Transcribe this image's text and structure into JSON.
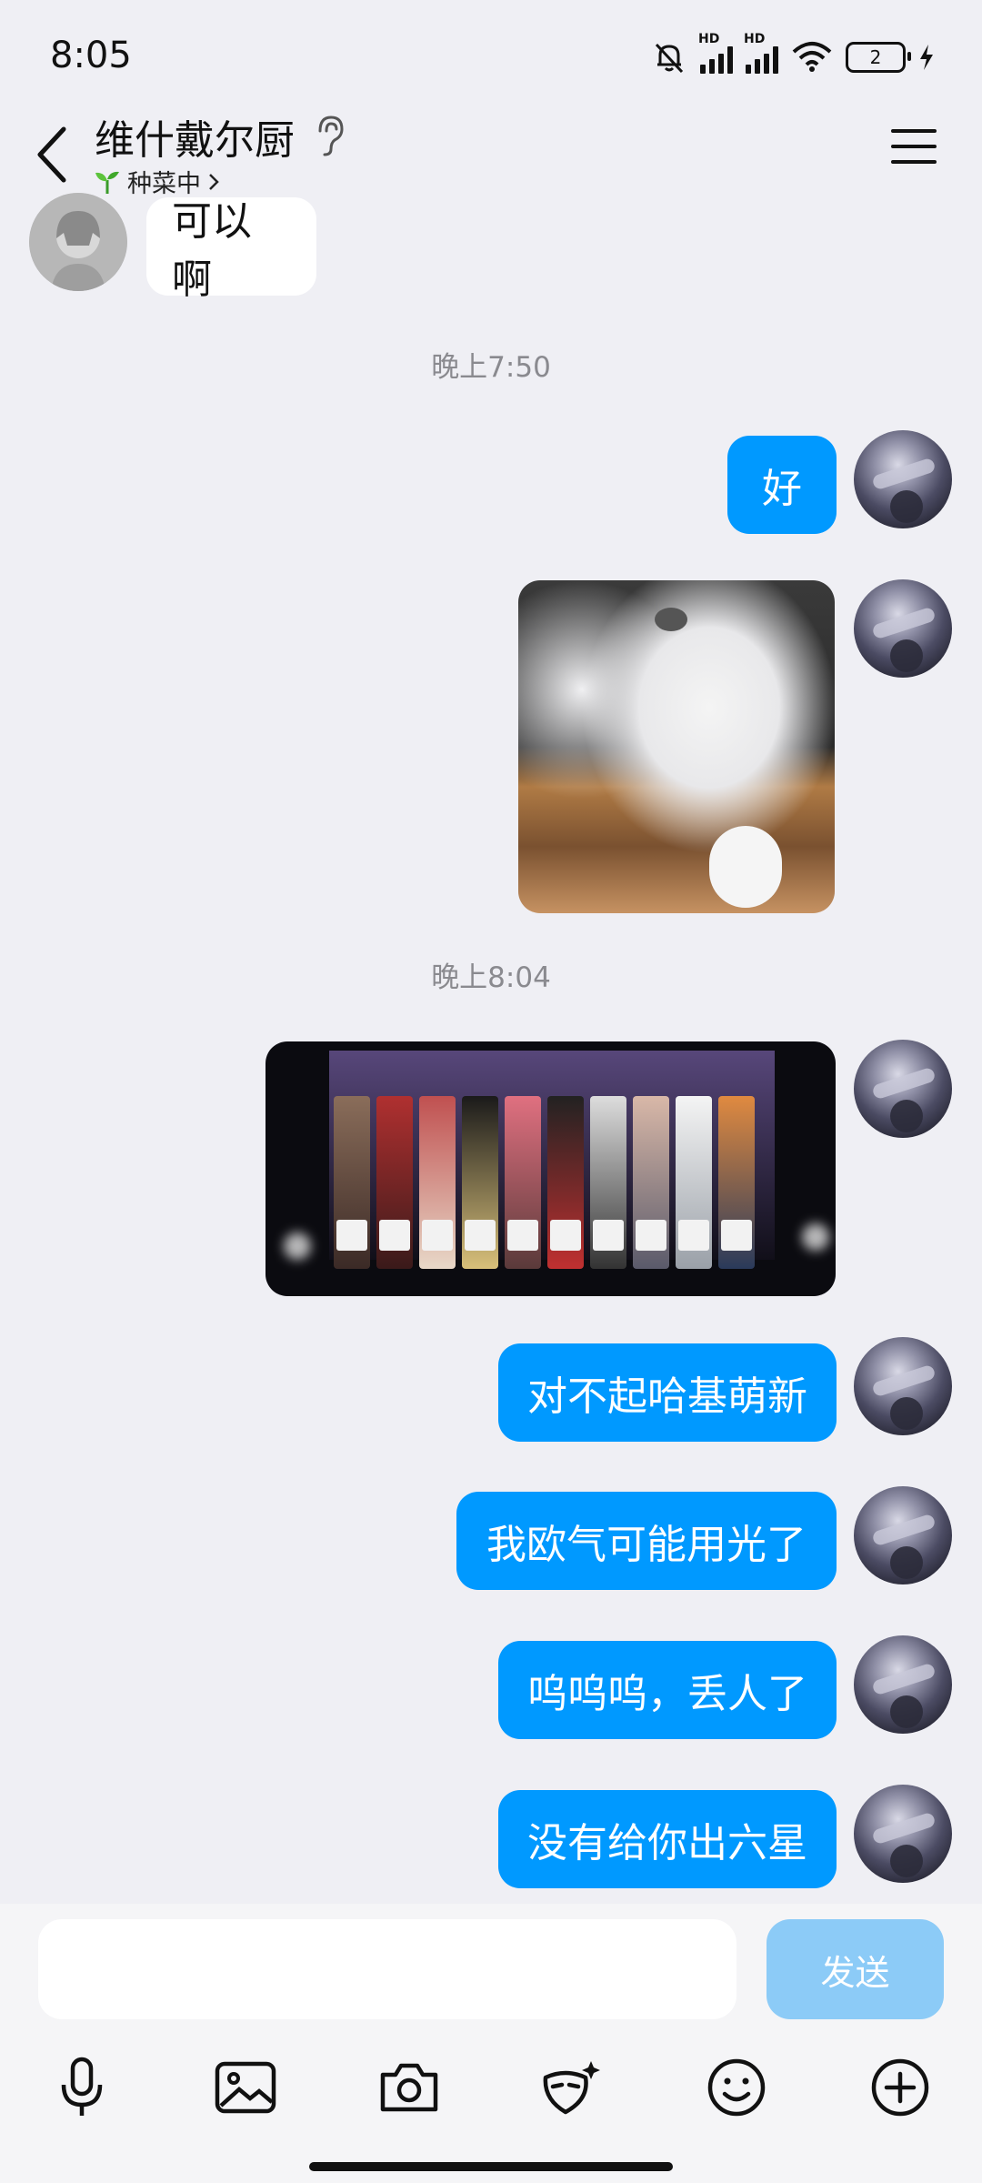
{
  "status_bar": {
    "time": "8:05",
    "battery": "2",
    "signal_labels": [
      "HD",
      "HD"
    ]
  },
  "header": {
    "title": "维什戴尔厨",
    "status": "种菜中",
    "status_icon": "sprout-icon"
  },
  "messages": {
    "peer_text": "可以啊",
    "time1": "晚上7:50",
    "msg_ok": "好",
    "time2": "晚上8:04",
    "msg_sorry": "对不起哈基萌新",
    "msg_luck": "我欧气可能用光了",
    "msg_cry": "呜呜呜，丢人了",
    "msg_six": "没有给你出六星"
  },
  "input": {
    "placeholder": "",
    "value": "",
    "send_label": "发送"
  },
  "colors": {
    "accent": "#0099FF",
    "send_disabled": "#8CCBF7",
    "background": "#EFEFF4"
  }
}
